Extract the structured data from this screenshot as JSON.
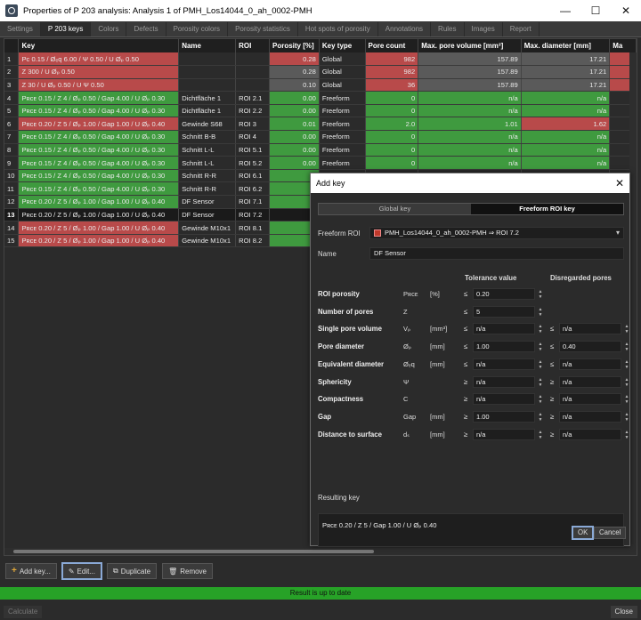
{
  "window": {
    "title": "Properties of P 203 analysis: Analysis 1 of PMH_Los14044_0_ah_0002-PMH"
  },
  "tabs": [
    "Settings",
    "P 203 keys",
    "Colors",
    "Defects",
    "Porosity colors",
    "Porosity statistics",
    "Hot spots of porosity",
    "Annotations",
    "Rules",
    "Images",
    "Report"
  ],
  "table": {
    "headers": [
      "",
      "Key",
      "Name",
      "ROI",
      "Porosity [%]",
      "Key type",
      "Pore count",
      "Max. pore volume [mm³]",
      "Max. diameter [mm]",
      "Ma"
    ],
    "rows": [
      {
        "n": "1",
        "key": "Pᴄ 0.15 / Øₑq 6.00 / Ψ 0.50 / U Øₚ 0.50",
        "name": "",
        "roi": "",
        "porosity": "0.28",
        "type": "Global",
        "count": "982",
        "maxvol": "157.89",
        "maxdia": "17.21",
        "k": "red",
        "pc": "red",
        "cc": "red",
        "vc": "grey",
        "dc": "grey"
      },
      {
        "n": "2",
        "key": "Z 300 / U Øₚ 0.50",
        "name": "",
        "roi": "",
        "porosity": "0.28",
        "type": "Global",
        "count": "982",
        "maxvol": "157.89",
        "maxdia": "17.21",
        "k": "red",
        "pc": "grey",
        "cc": "red",
        "vc": "grey",
        "dc": "grey"
      },
      {
        "n": "3",
        "key": "Z 30 / U Øₚ 0.50 / U Ψ 0.50",
        "name": "",
        "roi": "",
        "porosity": "0.10",
        "type": "Global",
        "count": "36",
        "maxvol": "157.89",
        "maxdia": "17.21",
        "k": "red",
        "pc": "grey",
        "cc": "red",
        "vc": "grey",
        "dc": "grey"
      },
      {
        "n": "4",
        "key": "Pʀᴄᴇ 0.15 / Z 4 / Øₚ 0.50 / Gap 4.00 / U Øₚ 0.30",
        "name": "Dichtfläche 1",
        "roi": "ROI 2.1",
        "porosity": "0.00",
        "type": "Freeform",
        "count": "0",
        "maxvol": "n/a",
        "maxdia": "n/a",
        "k": "green",
        "pc": "green",
        "cc": "green",
        "vc": "green",
        "dc": "green"
      },
      {
        "n": "5",
        "key": "Pʀᴄᴇ 0.15 / Z 4 / Øₚ 0.50 / Gap 4.00 / U Øₚ 0.30",
        "name": "Dichtfläche 1",
        "roi": "ROI 2.2",
        "porosity": "0.00",
        "type": "Freeform",
        "count": "0",
        "maxvol": "n/a",
        "maxdia": "n/a",
        "k": "green",
        "pc": "green",
        "cc": "green",
        "vc": "green",
        "dc": "green"
      },
      {
        "n": "6",
        "key": "Pʀᴄᴇ 0.20 / Z 5 / Øₚ 1.00 / Gap 1.00 / U Øₚ 0.40",
        "name": "Gewinde S68",
        "roi": "ROI 3",
        "porosity": "0.01",
        "type": "Freeform",
        "count": "2.0",
        "maxvol": "1.01",
        "maxdia": "1.62",
        "k": "red",
        "pc": "green",
        "cc": "green",
        "vc": "green",
        "dc": "red"
      },
      {
        "n": "7",
        "key": "Pʀᴄᴇ 0.15 / Z 4 / Øₚ 0.50 / Gap 4.00 / U Øₚ 0.30",
        "name": "Schnitt B-B",
        "roi": "ROI 4",
        "porosity": "0.00",
        "type": "Freeform",
        "count": "0",
        "maxvol": "n/a",
        "maxdia": "n/a",
        "k": "green",
        "pc": "green",
        "cc": "green",
        "vc": "green",
        "dc": "green"
      },
      {
        "n": "8",
        "key": "Pʀᴄᴇ 0.15 / Z 4 / Øₚ 0.50 / Gap 4.00 / U Øₚ 0.30",
        "name": "Schnitt L-L",
        "roi": "ROI 5.1",
        "porosity": "0.00",
        "type": "Freeform",
        "count": "0",
        "maxvol": "n/a",
        "maxdia": "n/a",
        "k": "green",
        "pc": "green",
        "cc": "green",
        "vc": "green",
        "dc": "green"
      },
      {
        "n": "9",
        "key": "Pʀᴄᴇ 0.15 / Z 4 / Øₚ 0.50 / Gap 4.00 / U Øₚ 0.30",
        "name": "Schnitt L-L",
        "roi": "ROI 5.2",
        "porosity": "0.00",
        "type": "Freeform",
        "count": "0",
        "maxvol": "n/a",
        "maxdia": "n/a",
        "k": "green",
        "pc": "green",
        "cc": "green",
        "vc": "green",
        "dc": "green"
      },
      {
        "n": "10",
        "key": "Pʀᴄᴇ 0.15 / Z 4 / Øₚ 0.50 / Gap 4.00 / U Øₚ 0.30",
        "name": "Schnitt R-R",
        "roi": "ROI 6.1",
        "porosity": "0",
        "type": "",
        "count": "",
        "maxvol": "",
        "maxdia": "",
        "k": "green",
        "pc": "green",
        "cc": "none",
        "vc": "none",
        "dc": "none"
      },
      {
        "n": "11",
        "key": "Pʀᴄᴇ 0.15 / Z 4 / Øₚ 0.50 / Gap 4.00 / U Øₚ 0.30",
        "name": "Schnitt R-R",
        "roi": "ROI 6.2",
        "porosity": "0",
        "type": "",
        "count": "",
        "maxvol": "",
        "maxdia": "",
        "k": "green",
        "pc": "green",
        "cc": "none",
        "vc": "none",
        "dc": "none"
      },
      {
        "n": "12",
        "key": "Pʀᴄᴇ 0.20 / Z 5 / Øₚ 1.00 / Gap 1.00 / U Øₚ 0.40",
        "name": "DF Sensor",
        "roi": "ROI 7.1",
        "porosity": "0",
        "type": "",
        "count": "",
        "maxvol": "",
        "maxdia": "",
        "k": "green",
        "pc": "green",
        "cc": "none",
        "vc": "none",
        "dc": "none"
      },
      {
        "n": "13",
        "key": "Pʀᴄᴇ 0.20 / Z 5 / Øₚ 1.00 / Gap 1.00 / U Øₚ 0.40",
        "name": "DF Sensor",
        "roi": "ROI 7.2",
        "porosity": "",
        "type": "",
        "count": "",
        "maxvol": "",
        "maxdia": "",
        "k": "sel",
        "pc": "sel",
        "cc": "none",
        "vc": "none",
        "dc": "none"
      },
      {
        "n": "14",
        "key": "Pʀᴄᴇ 0.20 / Z 5 / Øₚ 1.00 / Gap 1.00 / U Øₚ 0.40",
        "name": "Gewinde M10x1",
        "roi": "ROI 8.1",
        "porosity": "0",
        "type": "",
        "count": "",
        "maxvol": "",
        "maxdia": "",
        "k": "red",
        "pc": "green",
        "cc": "none",
        "vc": "none",
        "dc": "none"
      },
      {
        "n": "15",
        "key": "Pʀᴄᴇ 0.20 / Z 5 / Øₚ 1.00 / Gap 1.00 / U Øₚ 0.40",
        "name": "Gewinde M10x1",
        "roi": "ROI 8.2",
        "porosity": "0",
        "type": "",
        "count": "",
        "maxvol": "",
        "maxdia": "",
        "k": "red",
        "pc": "green",
        "cc": "none",
        "vc": "none",
        "dc": "none"
      }
    ]
  },
  "toolbar": {
    "add": "Add key...",
    "edit": "Edit...",
    "duplicate": "Duplicate",
    "remove": "Remove"
  },
  "status": {
    "text": "Result is up to date",
    "color": "#27a227"
  },
  "footer": {
    "calculate": "Calculate",
    "close": "Close"
  },
  "dialog": {
    "title": "Add key",
    "seg_global": "Global key",
    "seg_freeform": "Freeform ROI key",
    "roi_label": "Freeform ROI",
    "roi_value": "PMH_Los14044_0_ah_0002-PMH ⇒ ROI 7.2",
    "name_label": "Name",
    "name_value": "DF Sensor",
    "col_tolerance": "Tolerance value",
    "col_disregarded": "Disregarded pores",
    "params": [
      {
        "name": "ROI porosity",
        "sym": "Pʀᴄᴇ",
        "unit": "[%]",
        "op1": "≤",
        "v1": "0.20",
        "op2": "",
        "v2": ""
      },
      {
        "name": "Number of pores",
        "sym": "Z",
        "unit": "",
        "op1": "≤",
        "v1": "5",
        "op2": "",
        "v2": ""
      },
      {
        "name": "Single pore volume",
        "sym": "Vₚ",
        "unit": "[mm³]",
        "op1": "≤",
        "v1": "n/a",
        "op2": "≤",
        "v2": "n/a"
      },
      {
        "name": "Pore diameter",
        "sym": "Øₚ",
        "unit": "[mm]",
        "op1": "≤",
        "v1": "1.00",
        "op2": "≤",
        "v2": "0.40"
      },
      {
        "name": "Equivalent diameter",
        "sym": "Øₑq",
        "unit": "[mm]",
        "op1": "≤",
        "v1": "n/a",
        "op2": "≤",
        "v2": "n/a"
      },
      {
        "name": "Sphericity",
        "sym": "Ψ",
        "unit": "",
        "op1": "≥",
        "v1": "n/a",
        "op2": "≥",
        "v2": "n/a"
      },
      {
        "name": "Compactness",
        "sym": "C",
        "unit": "",
        "op1": "≥",
        "v1": "n/a",
        "op2": "≥",
        "v2": "n/a"
      },
      {
        "name": "Gap",
        "sym": "Gap",
        "unit": "[mm]",
        "op1": "≥",
        "v1": "1.00",
        "op2": "≥",
        "v2": "n/a"
      },
      {
        "name": "Distance to surface",
        "sym": "dₛ",
        "unit": "[mm]",
        "op1": "≥",
        "v1": "n/a",
        "op2": "≥",
        "v2": "n/a"
      }
    ],
    "result_label": "Resulting key",
    "result_value": "Pʀᴄᴇ 0.20 / Z 5 / Gap 1.00 / U Øₚ 0.40",
    "ok": "OK",
    "cancel": "Cancel"
  },
  "colors": {
    "red": "#b84a4a",
    "green": "#3f9a3f",
    "grey": "#5a5a5a",
    "accent": "#8aa9d6"
  }
}
